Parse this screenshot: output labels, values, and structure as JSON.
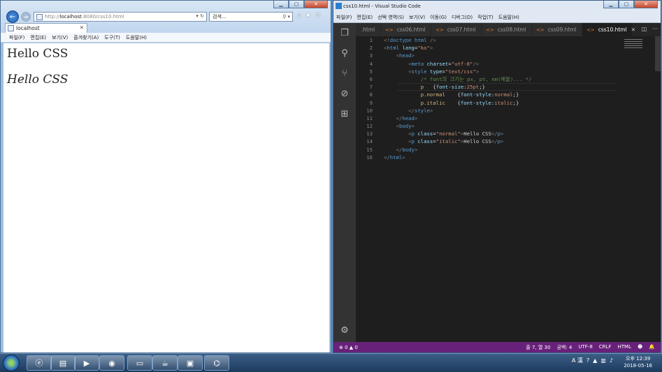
{
  "ie": {
    "url_prefix": "http://",
    "url_host": "localhost",
    "url_rest": ":8080/css10.html",
    "address_controls": "▾ ↻",
    "search_placeholder": "검색...",
    "search_controls": "⚲ ▾",
    "tab_title": "localhost",
    "menu": [
      "파일(F)",
      "편집(E)",
      "보기(V)",
      "즐겨찾기(A)",
      "도구(T)",
      "도움말(H)"
    ],
    "content": {
      "p1": "Hello CSS",
      "p2": "Hello CSS"
    }
  },
  "vscode": {
    "title": "css10.html - Visual Studio Code",
    "menu": [
      "파일(F)",
      "편집(E)",
      "선택 영역(S)",
      "보기(V)",
      "이동(G)",
      "디버그(D)",
      "작업(T)",
      "도움말(H)"
    ],
    "tabs": [
      ".html",
      "css06.html",
      "css07.html",
      "css08.html",
      "css09.html",
      "css10.html"
    ],
    "active_tab": "css10.html",
    "code": [
      [
        [
          "pn",
          "<!"
        ],
        [
          "tg",
          "doctype html"
        ],
        [
          "pn",
          " />"
        ]
      ],
      [
        [
          "pn",
          "<"
        ],
        [
          "tg",
          "html "
        ],
        [
          "at",
          "lang"
        ],
        [
          "tx",
          "="
        ],
        [
          "sv",
          "\"ko\""
        ],
        [
          "pn",
          ">"
        ]
      ],
      [
        [
          "tx",
          "    "
        ],
        [
          "pn",
          "<"
        ],
        [
          "tg",
          "head"
        ],
        [
          "pn",
          ">"
        ]
      ],
      [
        [
          "tx",
          "        "
        ],
        [
          "pn",
          "<"
        ],
        [
          "tg",
          "meta "
        ],
        [
          "at",
          "charset"
        ],
        [
          "tx",
          "="
        ],
        [
          "sv",
          "\"utf-8\""
        ],
        [
          "pn",
          "/>"
        ]
      ],
      [
        [
          "tx",
          "        "
        ],
        [
          "pn",
          "<"
        ],
        [
          "tg",
          "style "
        ],
        [
          "at",
          "type"
        ],
        [
          "tx",
          "="
        ],
        [
          "sv",
          "\"text/css\""
        ],
        [
          "pn",
          ">"
        ]
      ],
      [
        [
          "tx",
          "            "
        ],
        [
          "cm",
          "/* font의 크기는 px, pt, em(배율)... */"
        ]
      ],
      [
        [
          "tx",
          "            "
        ],
        [
          "sl",
          "p"
        ],
        [
          "tx",
          "   {"
        ],
        [
          "pr",
          "font-size"
        ],
        [
          "tx",
          ":"
        ],
        [
          "vl",
          "25pt"
        ],
        [
          "tx",
          ";}"
        ]
      ],
      [
        [
          "tx",
          "            "
        ],
        [
          "sl",
          "p.normal"
        ],
        [
          "tx",
          "    {"
        ],
        [
          "pr",
          "font-style"
        ],
        [
          "tx",
          ":"
        ],
        [
          "vl",
          "normal"
        ],
        [
          "tx",
          ";}"
        ]
      ],
      [
        [
          "tx",
          "            "
        ],
        [
          "sl",
          "p.italic"
        ],
        [
          "tx",
          "    {"
        ],
        [
          "pr",
          "font-style"
        ],
        [
          "tx",
          ":"
        ],
        [
          "vl",
          "italic"
        ],
        [
          "tx",
          ";}"
        ]
      ],
      [
        [
          "tx",
          "        "
        ],
        [
          "pn",
          "</"
        ],
        [
          "tg",
          "style"
        ],
        [
          "pn",
          ">"
        ]
      ],
      [
        [
          "tx",
          "    "
        ],
        [
          "pn",
          "</"
        ],
        [
          "tg",
          "head"
        ],
        [
          "pn",
          ">"
        ]
      ],
      [
        [
          "tx",
          "    "
        ],
        [
          "pn",
          "<"
        ],
        [
          "tg",
          "body"
        ],
        [
          "pn",
          ">"
        ]
      ],
      [
        [
          "tx",
          "        "
        ],
        [
          "pn",
          "<"
        ],
        [
          "tg",
          "p "
        ],
        [
          "at",
          "class"
        ],
        [
          "tx",
          "="
        ],
        [
          "sv",
          "\"normal\""
        ],
        [
          "pn",
          ">"
        ],
        [
          "tx",
          "Hello CSS"
        ],
        [
          "pn",
          "</"
        ],
        [
          "tg",
          "p"
        ],
        [
          "pn",
          ">"
        ]
      ],
      [
        [
          "tx",
          "        "
        ],
        [
          "pn",
          "<"
        ],
        [
          "tg",
          "p "
        ],
        [
          "at",
          "class"
        ],
        [
          "tx",
          "="
        ],
        [
          "sv",
          "\"italic\""
        ],
        [
          "pn",
          ">"
        ],
        [
          "tx",
          "Hello CSS"
        ],
        [
          "pn",
          "</"
        ],
        [
          "tg",
          "p"
        ],
        [
          "pn",
          ">"
        ]
      ],
      [
        [
          "tx",
          "    "
        ],
        [
          "pn",
          "</"
        ],
        [
          "tg",
          "body"
        ],
        [
          "pn",
          ">"
        ]
      ],
      [
        [
          "pn",
          "</"
        ],
        [
          "tg",
          "html"
        ],
        [
          "pn",
          ">"
        ]
      ]
    ],
    "current_line": 7,
    "status": {
      "left": "⊗ 0 ▲ 0",
      "cursor": "줄 7, 열 30",
      "spaces": "공백: 4",
      "encoding": "UTF-8",
      "eol": "CRLF",
      "language": "HTML",
      "smiley": "☻",
      "bell": "🔔"
    }
  },
  "taskbar": {
    "ime": "A 漢",
    "clock_time": "오후 12:39",
    "clock_date": "2018-05-16"
  },
  "colors": {
    "vscode_status": "#68217a",
    "vscode_bg": "#1e1e1e",
    "taskbar": "#1d3a5e"
  }
}
